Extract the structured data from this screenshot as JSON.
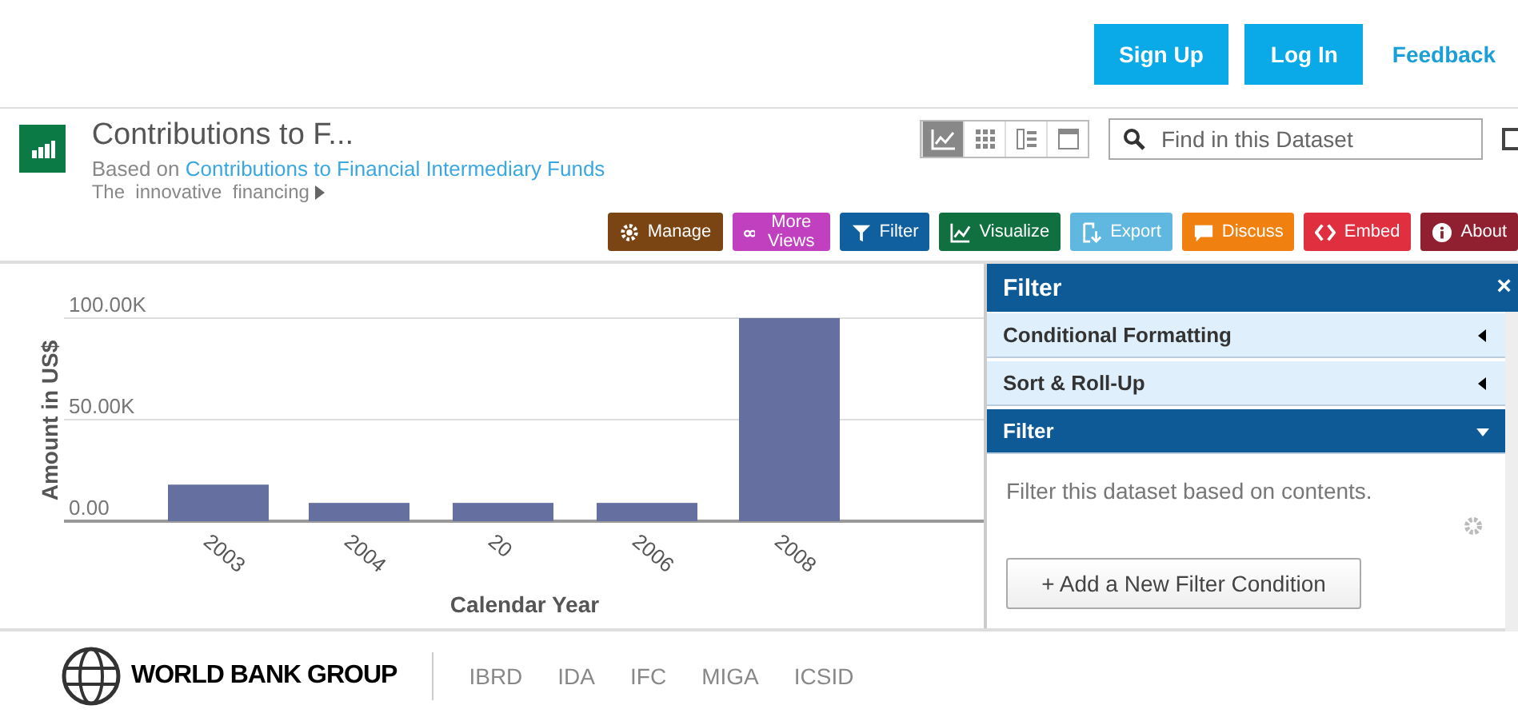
{
  "header": {
    "buttons": [
      {
        "label": "Sign Up"
      },
      {
        "label": "Log In"
      }
    ],
    "link": "Feedback"
  },
  "dataset": {
    "title": "Contributions to F...",
    "based_on_prefix": "Based on",
    "based_on_link": "Contributions to Financial Intermediary Funds",
    "description": "The  innovative  financing"
  },
  "view_modes": [
    {
      "selected": true
    },
    {
      "selected": false
    },
    {
      "selected": false
    },
    {
      "selected": false
    }
  ],
  "search": {
    "placeholder": "Find in this Dataset"
  },
  "actions": [
    {
      "label": "Manage",
      "color": "#7b4513"
    },
    {
      "label": "More Views",
      "color": "#c040c0"
    },
    {
      "label": "Filter",
      "color": "#1060a0"
    },
    {
      "label": "Visualize",
      "color": "#107040"
    },
    {
      "label": "Export",
      "color": "#60b8e0"
    },
    {
      "label": "Discuss",
      "color": "#f08010"
    },
    {
      "label": "Embed",
      "color": "#e03040"
    },
    {
      "label": "About",
      "color": "#902030"
    }
  ],
  "chart": {
    "chart_data": {
      "type": "bar",
      "xlabel": "Calendar Year",
      "ylabel": "Amount in US$",
      "categories": [
        "2003",
        "2004",
        "20",
        "2006",
        "2008"
      ],
      "series": [
        {
          "color": "#6570a0",
          "values": [
            18000,
            9000,
            9000,
            9000,
            100000
          ]
        }
      ],
      "ylim": [
        0,
        100000
      ],
      "yticks": [
        {
          "value": 0,
          "label": "0.00"
        },
        {
          "value": 50000,
          "label": "50.00K"
        },
        {
          "value": 100000,
          "label": "100.00K"
        }
      ]
    }
  },
  "panel": {
    "title": "Filter",
    "close": "×",
    "sections": [
      {
        "label": "Conditional Formatting",
        "expanded": false
      },
      {
        "label": "Sort & Roll-Up",
        "expanded": false
      },
      {
        "label": "Filter",
        "expanded": true
      }
    ],
    "hint": "Filter this dataset based on contents.",
    "add_button": "+ Add a New Filter Condition"
  },
  "footer": {
    "brand": "WORLD BANK GROUP",
    "links": [
      "IBRD",
      "IDA",
      "IFC",
      "MIGA",
      "ICSID"
    ]
  }
}
